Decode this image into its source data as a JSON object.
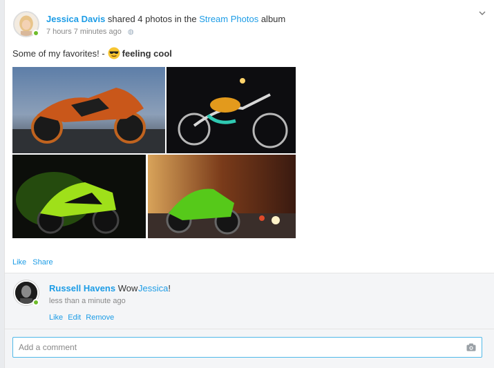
{
  "post": {
    "author": "Jessica Davis",
    "shared_text": "shared 4 photos in the",
    "album": "Stream Photos",
    "album_suffix": "album",
    "timestamp": "7 hours 7 minutes ago",
    "status_text": "Some of my favorites! -",
    "feeling": "feeling cool",
    "feeling_icon": "sunglasses-emoji-icon",
    "actions": {
      "like": "Like",
      "share": "Share"
    }
  },
  "photos": [
    {
      "name": "photo-orange-sportbike",
      "palette": "orange-sky"
    },
    {
      "name": "photo-chopper",
      "palette": "dark-chrome"
    },
    {
      "name": "photo-green-racer",
      "palette": "green-black"
    },
    {
      "name": "photo-green-ninja",
      "palette": "green-street"
    }
  ],
  "comment": {
    "author": "Russell Havens",
    "text_prefix": "Wow",
    "mention": "Jessica",
    "text_suffix": "!",
    "timestamp": "less than a minute ago",
    "actions": {
      "like": "Like",
      "edit": "Edit",
      "remove": "Remove"
    }
  },
  "comment_input": {
    "placeholder": "Add a comment",
    "icon": "camera-icon"
  },
  "colors": {
    "link": "#1c9ce6",
    "online": "#6fbd2b",
    "input_border": "#4fb8e8",
    "comments_bg": "#f4f5f7"
  }
}
